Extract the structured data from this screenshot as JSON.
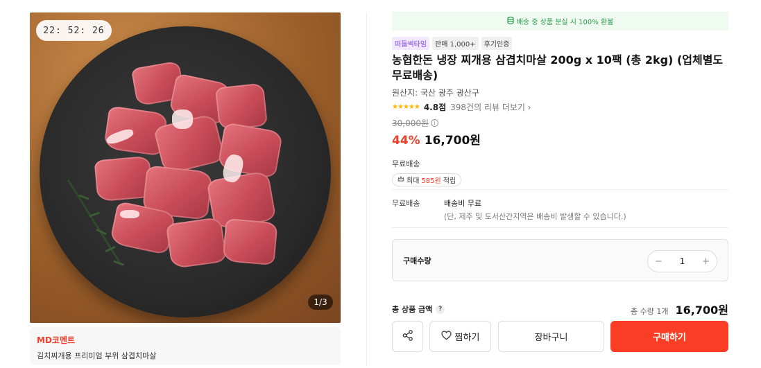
{
  "gallery": {
    "timer": "22: 52: 26",
    "counter": "1/3"
  },
  "md_comment": {
    "title": "MD코멘트",
    "text": "김치찌개용 프리미엄 부위 삼겹치마살"
  },
  "product": {
    "notice": "배송 중 상품 분실 시 100% 환불",
    "badges": [
      "떠들썩타임",
      "판매 1,000+",
      "후기인증"
    ],
    "title": "농협한돈 냉장 찌개용 삼겹치마살 200g x 10팩 (총 2kg) (업체별도 무료배송)",
    "origin": "원산지: 국산 광주 광산구",
    "rating": "4.8점",
    "review_link": "398건의 리뷰 더보기",
    "original_price": "30,000원",
    "discount": "44%",
    "price": "16,700원",
    "shipping_label": "무료배송",
    "points_prefix": "최대",
    "points_amount": "585원",
    "points_suffix": "적립"
  },
  "shipping": {
    "key": "무료배송",
    "value": "배송비 무료",
    "sub": "(단, 제주 및 도서산간지역은 배송비 발생할 수 있습니다.)"
  },
  "quantity": {
    "label": "구매수량",
    "value": "1"
  },
  "total": {
    "label": "총 상품 금액",
    "qty_text": "총 수량 1개",
    "price": "16,700원"
  },
  "buttons": {
    "wish": "찜하기",
    "cart": "장바구니",
    "buy": "구매하기"
  },
  "colors": {
    "accent": "#fa3e26",
    "notice_green": "#2c9e4b"
  }
}
